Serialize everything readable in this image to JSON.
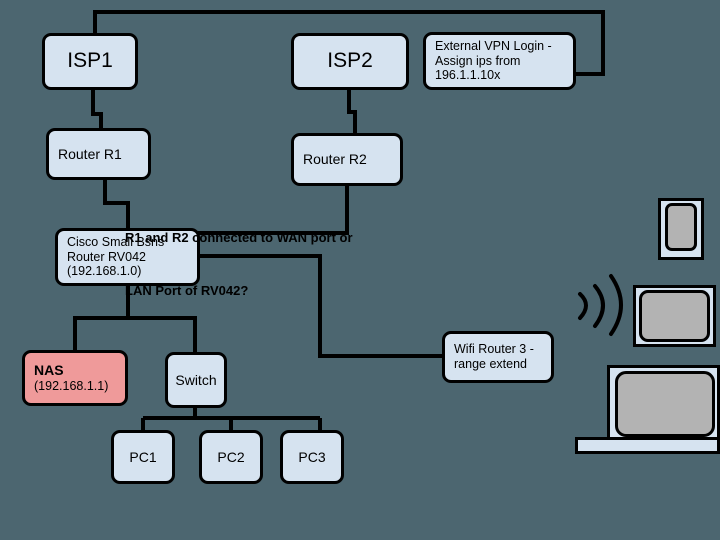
{
  "diagram": {
    "title": "Home network topology with dual ISP, RV042 router, NAS, switch and wifi range extender",
    "background_color": "#4c6670",
    "node_fill": "#d6e3f0",
    "nas_fill": "#ef9a9a",
    "stroke_color": "#000000",
    "device_screen_color": "#b3b3b3"
  },
  "nodes": {
    "isp1": {
      "label": "ISP1"
    },
    "isp2": {
      "label": "ISP2"
    },
    "vpn": {
      "line1": "External VPN Login -",
      "line2": "Assign ips from",
      "line3": "196.1.1.10x"
    },
    "router_r1": {
      "label": "Router R1"
    },
    "router_r2": {
      "label": "Router R2"
    },
    "rv042": {
      "line1": "Cisco Small Bsns",
      "line2": "Router RV042",
      "line3": "(192.168.1.0)"
    },
    "nas": {
      "line1": "NAS",
      "line2": "(192.168.1.1)"
    },
    "switch": {
      "label": "Switch"
    },
    "pc1": {
      "label": "PC1"
    },
    "pc2": {
      "label": "PC2"
    },
    "pc3": {
      "label": "PC3"
    },
    "wifi_router": {
      "line1": "Wifi Router 3 -",
      "line2": "range extend"
    }
  },
  "annotation": {
    "line1": "R1 and R2 connected to WAN port or",
    "line2": "LAN Port of RV042?"
  },
  "devices": {
    "phone": "phone-device-icon",
    "tablet": "tablet-device-icon",
    "laptop": "laptop-device-icon",
    "wifi_signal": "wifi-signal-icon"
  }
}
